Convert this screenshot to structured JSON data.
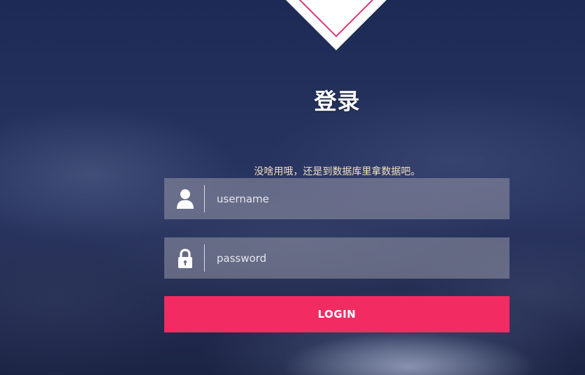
{
  "header": {
    "title": "登录",
    "subtitle": "没啥用哦，还是到数据库里拿数据吧。",
    "emblem_icon": "diamond-logo-icon"
  },
  "form": {
    "username": {
      "icon": "user-icon",
      "placeholder": "username",
      "value": ""
    },
    "password": {
      "icon": "lock-icon",
      "placeholder": "password",
      "value": ""
    },
    "login_label": "LOGIN"
  },
  "colors": {
    "accent": "#f22c63",
    "subtitle_text": "#f2dfc0",
    "field_background": "rgba(150,150,165,0.55)"
  }
}
